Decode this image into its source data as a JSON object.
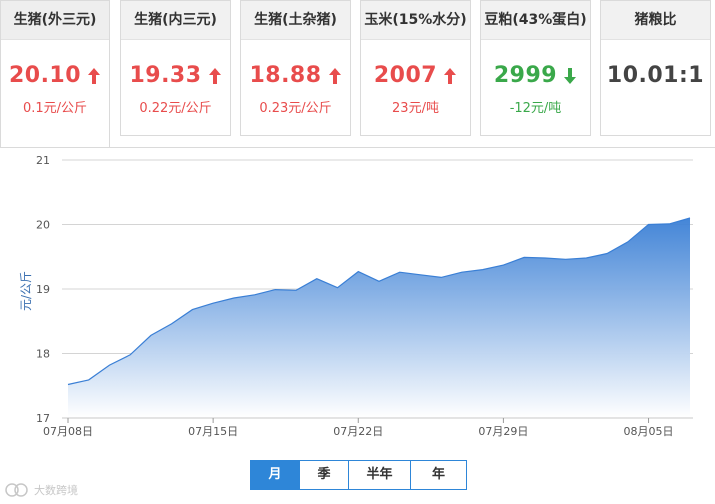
{
  "cards": [
    {
      "title": "生猪(外三元)",
      "price": "20.10",
      "change": "0.1元/公斤",
      "trend": "up",
      "color": "#e84c4c"
    },
    {
      "title": "生猪(内三元)",
      "price": "19.33",
      "change": "0.22元/公斤",
      "trend": "up",
      "color": "#e84c4c"
    },
    {
      "title": "生猪(土杂猪)",
      "price": "18.88",
      "change": "0.23元/公斤",
      "trend": "up",
      "color": "#e84c4c"
    },
    {
      "title": "玉米(15%水分)",
      "price": "2007",
      "change": "23元/吨",
      "trend": "up",
      "color": "#e84c4c"
    },
    {
      "title": "豆粕(43%蛋白)",
      "price": "2999",
      "change": "-12元/吨",
      "trend": "down",
      "color": "#3aa84a"
    },
    {
      "title": "猪粮比",
      "price": "10.01:1",
      "change": "",
      "trend": "none",
      "color": "#444444"
    }
  ],
  "chart_data": {
    "type": "area",
    "xlabel": "",
    "ylabel": "元/公斤",
    "ylim": [
      17,
      21
    ],
    "yticks": [
      17,
      18,
      19,
      20,
      21
    ],
    "xtick_labels": [
      "07月08日",
      "07月15日",
      "07月22日",
      "07月29日",
      "08月05日"
    ],
    "xtick_indices": [
      0,
      7,
      14,
      21,
      28
    ],
    "grid": true,
    "legend": "none",
    "line_color": "#3a7fd5",
    "fill_top": "#3a7fd5",
    "fill_bottom": "#ffffff",
    "x": [
      "07月08日",
      "07月09日",
      "07月10日",
      "07月11日",
      "07月12日",
      "07月13日",
      "07月14日",
      "07月15日",
      "07月16日",
      "07月17日",
      "07月18日",
      "07月19日",
      "07月20日",
      "07月21日",
      "07月22日",
      "07月23日",
      "07月24日",
      "07月25日",
      "07月26日",
      "07月27日",
      "07月28日",
      "07月29日",
      "07月30日",
      "07月31日",
      "08月01日",
      "08月02日",
      "08月03日",
      "08月04日",
      "08月05日",
      "08月06日",
      "08月07日"
    ],
    "values": [
      17.52,
      17.59,
      17.82,
      17.98,
      18.28,
      18.46,
      18.68,
      18.78,
      18.86,
      18.91,
      18.99,
      18.98,
      19.16,
      19.02,
      19.27,
      19.12,
      19.26,
      19.22,
      19.18,
      19.26,
      19.3,
      19.37,
      19.49,
      19.48,
      19.46,
      19.48,
      19.55,
      19.73,
      20.0,
      20.01,
      20.1
    ]
  },
  "tabs": [
    {
      "label": "月",
      "active": true
    },
    {
      "label": "季",
      "active": false
    },
    {
      "label": "半年",
      "active": false
    },
    {
      "label": "年",
      "active": false
    }
  ],
  "watermark": "大数跨境"
}
